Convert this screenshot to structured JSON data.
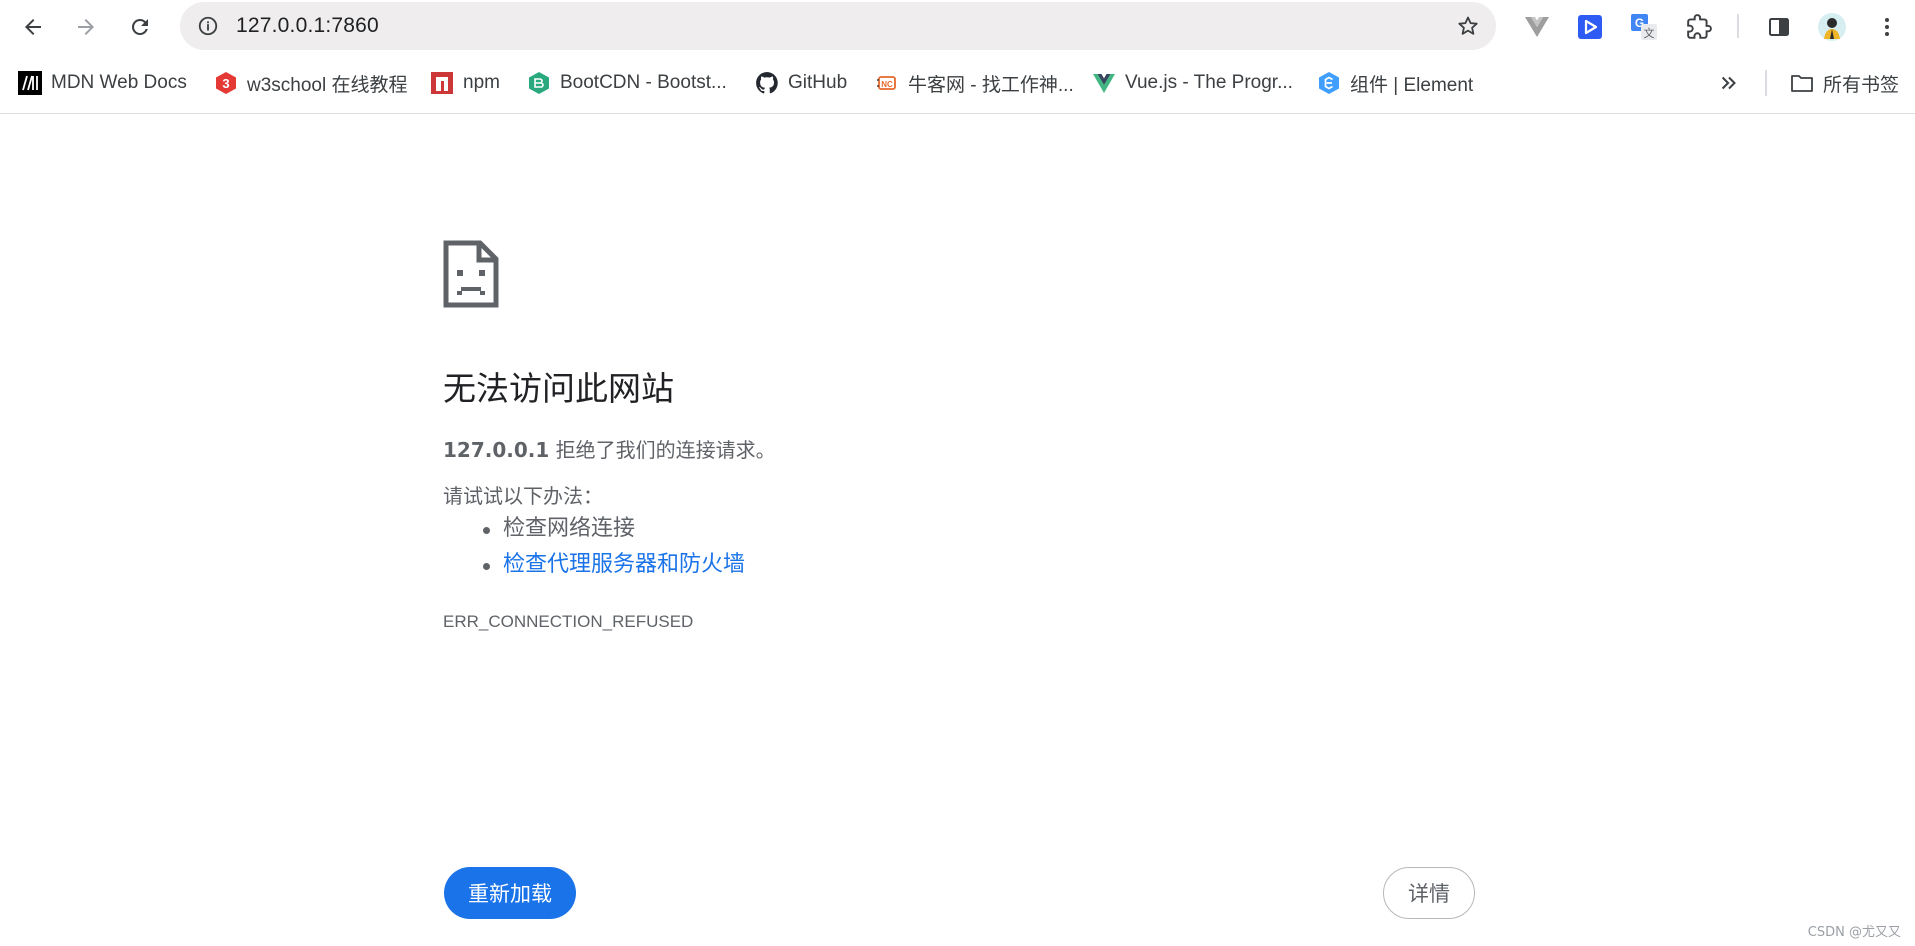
{
  "toolbar": {
    "back_icon": "arrow-left-icon",
    "forward_icon": "arrow-right-icon",
    "reload_icon": "reload-icon",
    "url": "127.0.0.1:7860",
    "site_info_icon": "info-icon",
    "bookmark_star_icon": "star-icon",
    "extensions": [
      "vue-devtools-icon",
      "immersive-translate-icon",
      "google-translate-icon",
      "puzzle-extensions-icon"
    ],
    "side_panel_icon": "side-panel-icon",
    "menu_icon": "more-vert-icon"
  },
  "bookmarks": {
    "items": [
      {
        "label": "MDN Web Docs",
        "icon": "mdn-icon"
      },
      {
        "label": "w3school 在线教程",
        "icon": "w3school-icon"
      },
      {
        "label": "npm",
        "icon": "npm-icon"
      },
      {
        "label": "BootCDN - Bootst...",
        "icon": "bootcdn-icon"
      },
      {
        "label": "GitHub",
        "icon": "github-icon"
      },
      {
        "label": "牛客网 - 找工作神...",
        "icon": "nowcoder-icon"
      },
      {
        "label": "Vue.js - The Progr...",
        "icon": "vue-icon"
      },
      {
        "label": "组件 | Element",
        "icon": "element-icon"
      }
    ],
    "overflow_icon": "double-chevron-icon",
    "all_bookmarks_label": "所有书签"
  },
  "error_page": {
    "title": "无法访问此网站",
    "host": "127.0.0.1",
    "description": " 拒绝了我们的连接请求。",
    "try_label": "请试试以下办法：",
    "suggestions": [
      {
        "text": "检查网络连接",
        "is_link": false
      },
      {
        "text": "检查代理服务器和防火墙",
        "is_link": true
      }
    ],
    "error_code": "ERR_CONNECTION_REFUSED",
    "reload_button": "重新加载",
    "details_button": "详情"
  },
  "watermark": "CSDN @尤又又",
  "colors": {
    "accent": "#1a73e8",
    "text_secondary": "#5f6368",
    "omnibox_bg": "#efeded"
  }
}
